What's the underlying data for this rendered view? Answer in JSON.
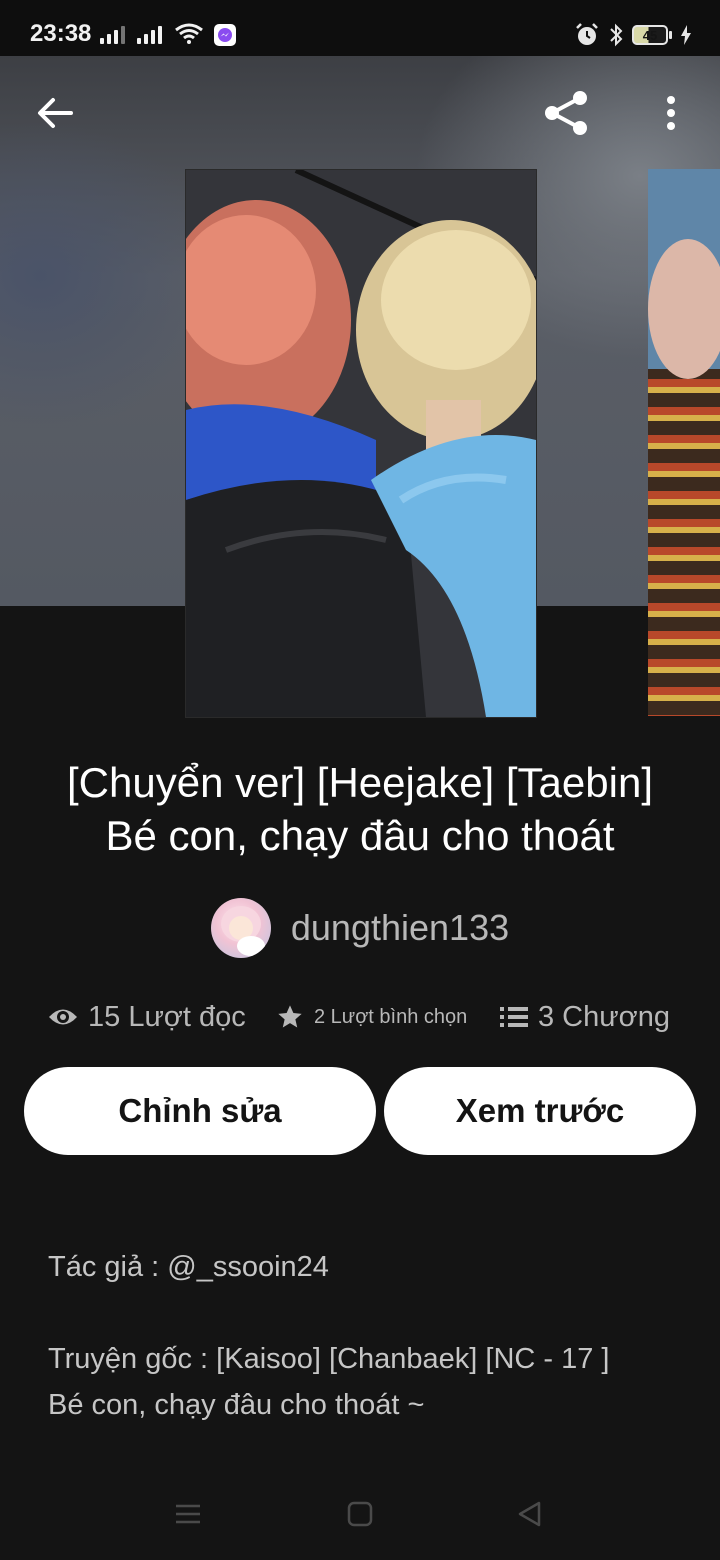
{
  "status_bar": {
    "time": "23:38",
    "battery_level": "45",
    "icons": [
      "signal-icon",
      "signal-icon",
      "wifi-icon",
      "messenger-icon",
      "alarm-icon",
      "bluetooth-icon",
      "battery-icon",
      "charging-icon"
    ]
  },
  "top_bar": {
    "icons": [
      "back-arrow-icon",
      "share-icon",
      "more-vertical-icon"
    ]
  },
  "story": {
    "title_line1": "[Chuyển ver] [Heejake] [Taebin]",
    "title_line2": "Bé con, chạy đâu cho thoát",
    "author": "dungthien133",
    "stats": {
      "reads": "15 Lượt đọc",
      "votes": "2 Lượt bình chọn",
      "chapters": "3 Chương"
    },
    "buttons": {
      "edit": "Chỉnh sửa",
      "preview": "Xem trước"
    },
    "description": {
      "line1": "Tác giả : @_ssooin24",
      "line2": "Truyện gốc : [Kaisoo] [Chanbaek] [NC - 17 ]",
      "line3": "Bé con, chạy đâu cho thoát ~"
    }
  },
  "nav_bar": {
    "icons": [
      "menu-icon",
      "home-icon",
      "back-icon"
    ]
  },
  "colors": {
    "background": "#141414",
    "button_bg": "#ffffff",
    "muted_text": "#b8b8b8"
  }
}
